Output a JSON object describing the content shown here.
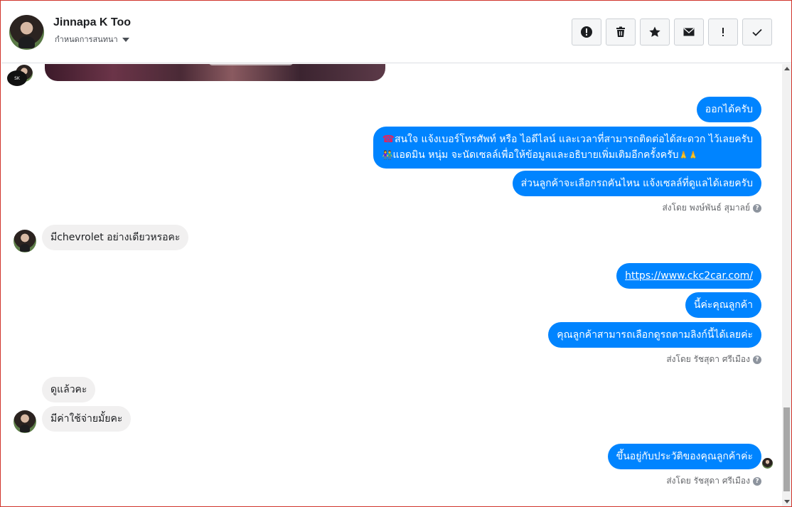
{
  "header": {
    "name": "Jinnapa K Too",
    "subtitle": "กำหนดการสนทนา",
    "toolbar": [
      {
        "icon": "alert-circle-icon",
        "name": "report-button"
      },
      {
        "icon": "trash-icon",
        "name": "delete-button"
      },
      {
        "icon": "star-icon",
        "name": "star-button"
      },
      {
        "icon": "mail-icon",
        "name": "mark-unread-button"
      },
      {
        "icon": "exclamation-icon",
        "name": "spam-button"
      },
      {
        "icon": "check-icon",
        "name": "done-button"
      }
    ]
  },
  "chat": {
    "image_logo_text": "SK",
    "messages": [
      {
        "id": "m1",
        "direction": "out",
        "text": "ออกได้ครับ"
      },
      {
        "id": "m2",
        "direction": "out",
        "line1": "สนใจ แจ้งเบอร์โทรศัพท์ หรือ ไอดีไลน์ และเวลาที่สามารถติดต่อได้สะดวก ไว้เลยครับ",
        "line2": "แอดมิน หนุ่ม จะนัดเซลล์เพื่อให้ข้อมูลและอธิบายเพิ่มเติมอีกครั้งครับ",
        "emoji_phone": "☎",
        "emoji_people": "👫",
        "emoji_pray": "🙏🙏"
      },
      {
        "id": "m3",
        "direction": "out",
        "text": "ส่วนลูกค้าจะเลือกรถคันไหน แจ้งเซลล์ที่ดูแลได้เลยครับ"
      },
      {
        "id": "s1",
        "sent_by": "ส่งโดย พงษ์พันธ์ สุมาลย์"
      },
      {
        "id": "m4",
        "direction": "in",
        "text": "มีchevrolet อย่างเดียวหรอคะ"
      },
      {
        "id": "m5",
        "direction": "out",
        "text": "https://www.ckc2car.com/"
      },
      {
        "id": "m6",
        "direction": "out",
        "text": "นี้ค่ะคุณลูกค้า"
      },
      {
        "id": "m7",
        "direction": "out",
        "text": "คุณลูกค้าสามารถเลือกดูรถตามลิงก์นี้ได้เลยค่ะ"
      },
      {
        "id": "s2",
        "sent_by": "ส่งโดย รัชสุดา ศรีเมือง"
      },
      {
        "id": "m8",
        "direction": "in",
        "text": "ดูแล้วคะ"
      },
      {
        "id": "m9",
        "direction": "in",
        "text": "มีค่าใช้จ่ายมั้ยคะ"
      },
      {
        "id": "m10",
        "direction": "out",
        "text": "ขึ้นอยู่กับประวัติของคุณลูกค้าค่ะ"
      },
      {
        "id": "s3",
        "sent_by": "ส่งโดย รัชสุดา ศรีเมือง"
      }
    ]
  },
  "colors": {
    "outgoing_bubble": "#0084ff",
    "incoming_bubble": "#f1f0f0",
    "frame_border": "#d0342c"
  }
}
